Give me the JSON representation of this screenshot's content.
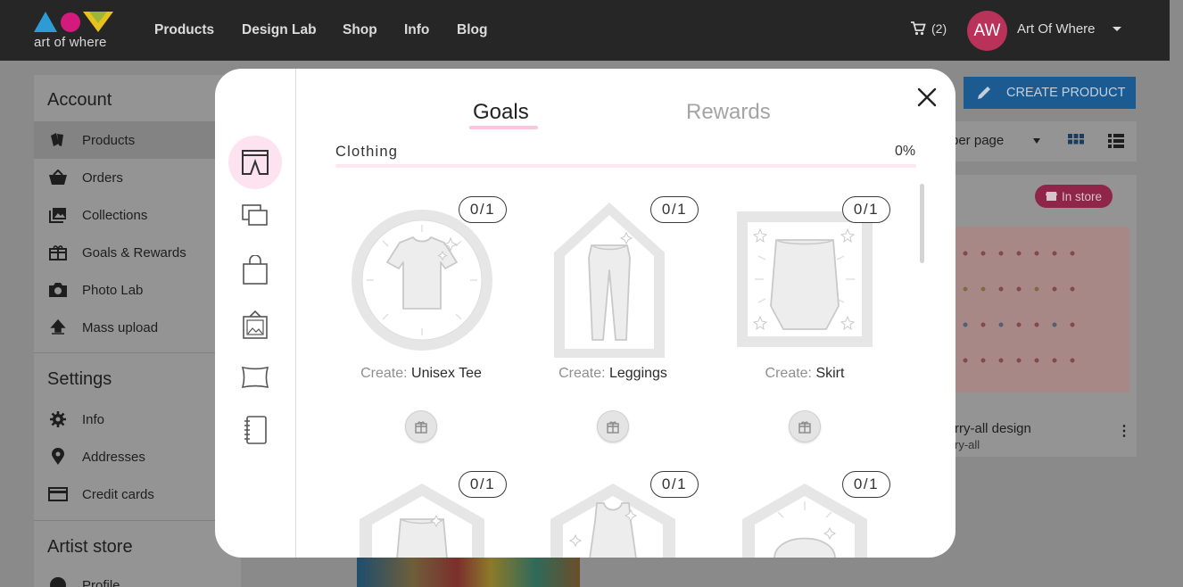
{
  "topnav": {
    "logo_text": "art of where",
    "links": [
      "Products",
      "Design Lab",
      "Shop",
      "Info",
      "Blog"
    ],
    "cart_count": "(2)",
    "avatar_initials": "AW",
    "account_name": "Art Of Where"
  },
  "sidebar": {
    "account_heading": "Account",
    "account_items": [
      {
        "label": "Products",
        "icon": "products-icon"
      },
      {
        "label": "Orders",
        "icon": "basket-icon"
      },
      {
        "label": "Collections",
        "icon": "collections-icon"
      },
      {
        "label": "Goals & Rewards",
        "icon": "gift-icon"
      },
      {
        "label": "Photo Lab",
        "icon": "camera-icon"
      },
      {
        "label": "Mass upload",
        "icon": "upload-icon"
      }
    ],
    "settings_heading": "Settings",
    "settings_items": [
      {
        "label": "Info",
        "icon": "gear-icon"
      },
      {
        "label": "Addresses",
        "icon": "location-pin-icon"
      },
      {
        "label": "Credit cards",
        "icon": "credit-card-icon"
      }
    ],
    "artist_heading": "Artist store",
    "artist_items": [
      {
        "label": "Profile",
        "icon": "profile-icon"
      }
    ]
  },
  "main": {
    "create_button": "CREATE PRODUCT",
    "per_page": "per page",
    "card": {
      "badge": "In store",
      "title": "rry-all design",
      "subtitle": "ry-all"
    }
  },
  "modal": {
    "tabs": [
      "Goals",
      "Rewards"
    ],
    "active_tab": "Goals",
    "category": {
      "label": "Clothing",
      "percent": "0%",
      "progress": 0
    },
    "rail_icons": [
      "shorts-icon",
      "layers-icon",
      "bag-icon",
      "framed-print-icon",
      "pillow-icon",
      "notebook-icon"
    ],
    "goals": [
      {
        "count": "0/1",
        "prefix": "Create:",
        "name": "Unisex Tee",
        "icon": "tee-icon"
      },
      {
        "count": "0/1",
        "prefix": "Create:",
        "name": "Leggings",
        "icon": "leggings-icon"
      },
      {
        "count": "0/1",
        "prefix": "Create:",
        "name": "Skirt",
        "icon": "skirt-icon"
      },
      {
        "count": "0/1",
        "icon": "shorts-badge-icon"
      },
      {
        "count": "0/1",
        "icon": "tank-top-icon"
      },
      {
        "count": "0/1",
        "icon": "hat-icon"
      }
    ]
  },
  "colors": {
    "accent_pink": "#f9c6dd",
    "brand_blue": "#1b5b92",
    "topbar": "#262626"
  }
}
